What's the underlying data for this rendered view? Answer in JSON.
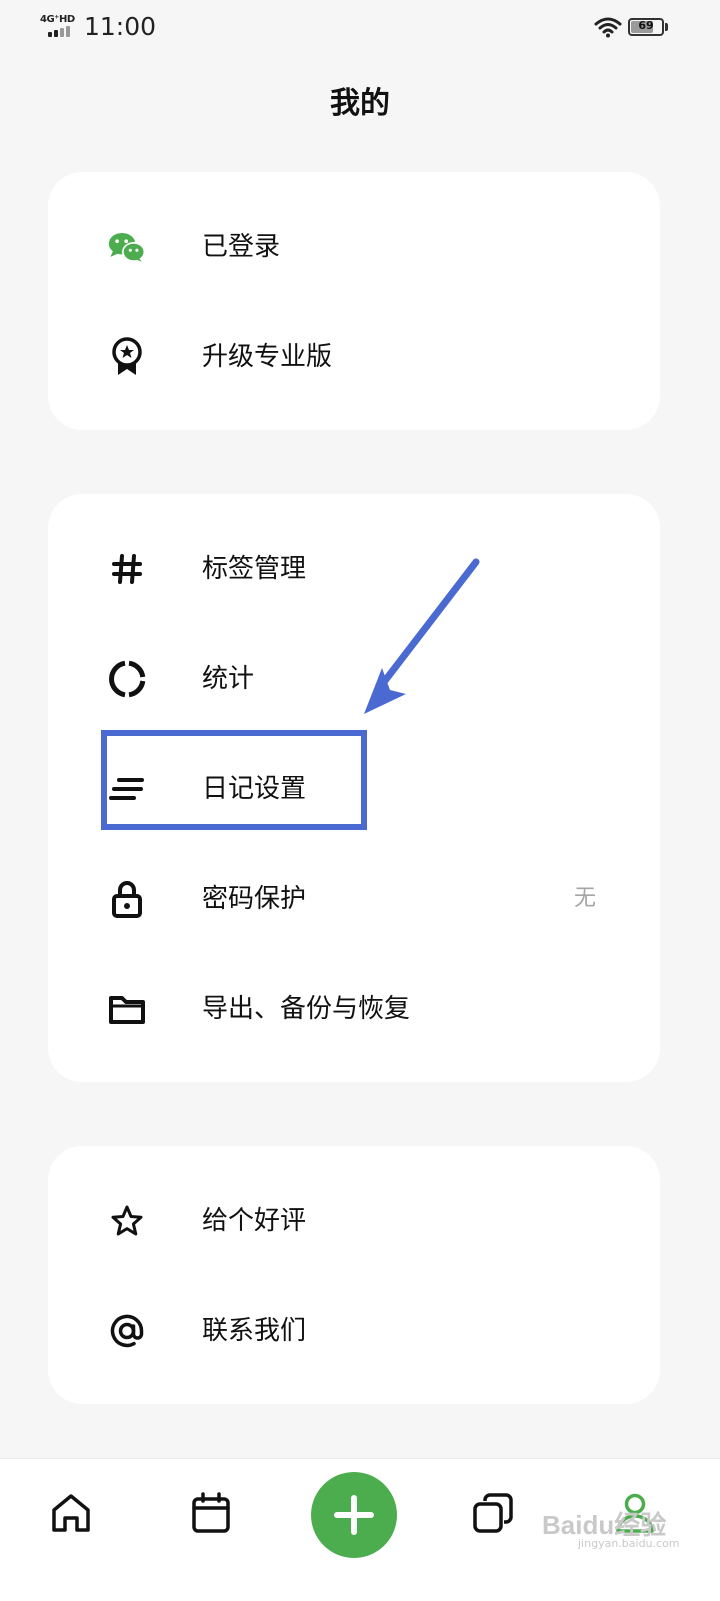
{
  "status_bar": {
    "network": "4G⁺HD",
    "time": "11:00",
    "battery": "69",
    "battery_level": 0.69
  },
  "header": {
    "title": "我的"
  },
  "account_section": {
    "items": [
      {
        "label": "已登录",
        "icon": "wechat-icon"
      },
      {
        "label": "升级专业版",
        "icon": "award-badge-icon"
      }
    ]
  },
  "settings_section": {
    "items": [
      {
        "label": "标签管理",
        "icon": "hashtag-icon"
      },
      {
        "label": "统计",
        "icon": "donut-chart-icon"
      },
      {
        "label": "日记设置",
        "icon": "text-lines-icon"
      },
      {
        "label": "密码保护",
        "icon": "lock-icon",
        "value": "无"
      },
      {
        "label": "导出、备份与恢复",
        "icon": "folder-icon"
      }
    ]
  },
  "feedback_section": {
    "items": [
      {
        "label": "给个好评",
        "icon": "star-icon"
      },
      {
        "label": "联系我们",
        "icon": "at-icon"
      }
    ]
  },
  "annotation": {
    "color": "#4a69d1",
    "target": "日记设置"
  },
  "bottom_nav": {
    "items": [
      {
        "icon": "home-icon"
      },
      {
        "icon": "calendar-icon"
      },
      {
        "icon": "plus-icon"
      },
      {
        "icon": "copy-icon"
      },
      {
        "icon": "profile-icon",
        "active": true
      }
    ],
    "accent": "#4cad4e",
    "watermark": "Baidu经验",
    "watermark_url": "jingyan.baidu.com"
  }
}
